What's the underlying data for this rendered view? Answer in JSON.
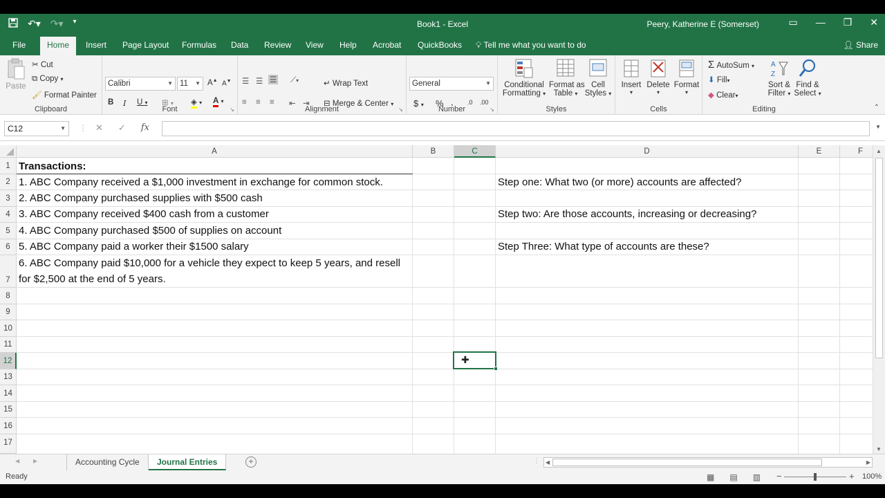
{
  "window": {
    "doc_title": "Book1  -  Excel",
    "user": "Peery, Katherine E (Somerset)"
  },
  "tabs": [
    "File",
    "Home",
    "Insert",
    "Page Layout",
    "Formulas",
    "Data",
    "Review",
    "View",
    "Help",
    "Acrobat",
    "QuickBooks"
  ],
  "tell_me": "Tell me what you want to do",
  "share": "Share",
  "ribbon": {
    "clipboard": {
      "paste": "Paste",
      "cut": "Cut",
      "copy": "Copy",
      "format_painter": "Format Painter",
      "label": "Clipboard"
    },
    "font": {
      "name": "Calibri",
      "size": "11",
      "label": "Font"
    },
    "alignment": {
      "wrap_text": "Wrap Text",
      "merge_center": "Merge & Center",
      "label": "Alignment"
    },
    "number": {
      "format": "General",
      "label": "Number"
    },
    "styles": {
      "conditional_1": "Conditional",
      "conditional_2": "Formatting",
      "format_as_1": "Format as",
      "format_as_2": "Table",
      "cell_1": "Cell",
      "cell_2": "Styles",
      "label": "Styles"
    },
    "cells": {
      "insert": "Insert",
      "delete": "Delete",
      "format": "Format",
      "label": "Cells"
    },
    "editing": {
      "autosum": "AutoSum",
      "fill": "Fill",
      "clear": "Clear",
      "sort_1": "Sort &",
      "sort_2": "Filter",
      "find_1": "Find &",
      "find_2": "Select",
      "label": "Editing"
    }
  },
  "formula_bar": {
    "name_box": "C12",
    "fx": "fx",
    "formula": ""
  },
  "columns": [
    "A",
    "B",
    "C",
    "D",
    "E",
    "F"
  ],
  "rows": [
    "1",
    "2",
    "3",
    "4",
    "5",
    "6",
    "7",
    "8",
    "9",
    "10",
    "11",
    "12",
    "13",
    "14",
    "15",
    "16",
    "17"
  ],
  "cells": {
    "A1": "Transactions:",
    "A2": "1. ABC Company received a $1,000 investment in exchange for common stock.",
    "A3": "2. ABC Company purchased supplies with $500 cash",
    "A4": "3. ABC Company received $400 cash from a customer",
    "A5": "4. ABC Company purchased $500 of supplies on account",
    "A6": "5. ABC Company paid a worker their $1500 salary",
    "A7": "6. ABC Company paid $10,000 for a vehicle they expect to keep 5 years, and resell for $2,500 at the end of 5 years.",
    "D2": "Step one: What two (or more) accounts are affected?",
    "D4": "Step two: Are those accounts, increasing or decreasing?",
    "D6": "Step Three: What type of accounts are these?"
  },
  "sheets": [
    "Accounting Cycle",
    "Journal Entries"
  ],
  "active_sheet": "Journal Entries",
  "status": {
    "ready": "Ready",
    "zoom": "100%"
  },
  "colors": {
    "accent": "#217346"
  }
}
